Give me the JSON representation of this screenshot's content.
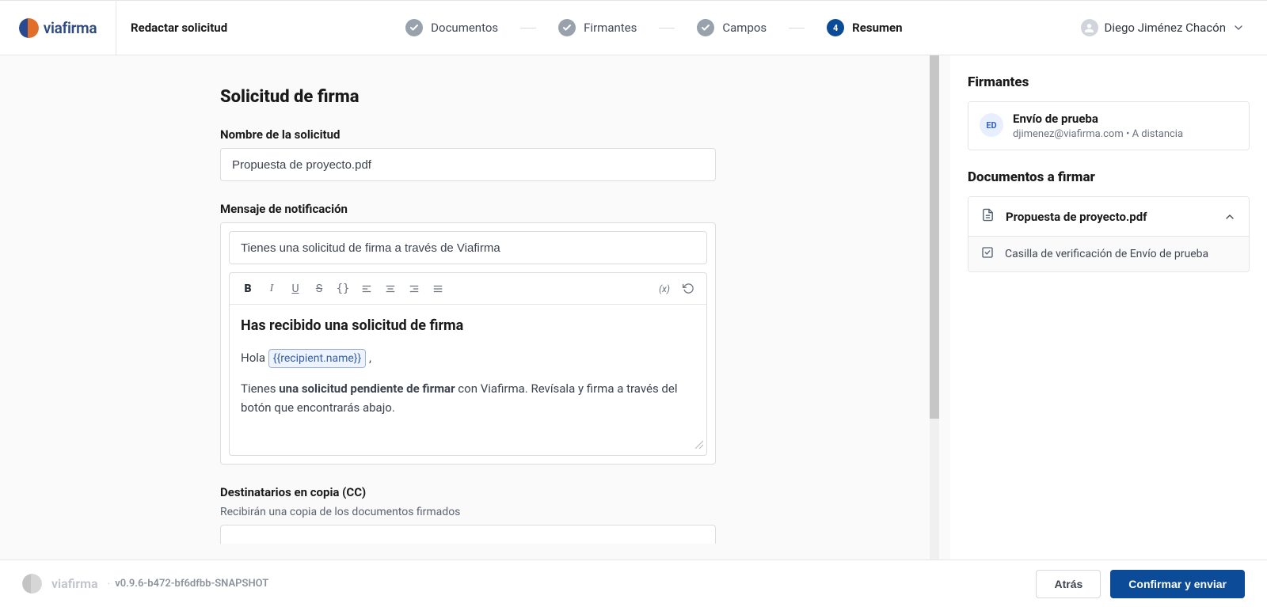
{
  "brand": {
    "name": "viafirma"
  },
  "header": {
    "page_label": "Redactar solicitud",
    "steps": [
      {
        "label": "Documentos"
      },
      {
        "label": "Firmantes"
      },
      {
        "label": "Campos"
      },
      {
        "label": "Resumen",
        "number": "4"
      }
    ],
    "user_name": "Diego Jiménez Chacón"
  },
  "form": {
    "title": "Solicitud de firma",
    "name_label": "Nombre de la solicitud",
    "name_value": "Propuesta de proyecto.pdf",
    "message_label": "Mensaje de notificación",
    "subject_value": "Tienes una solicitud de firma a través de Viafirma",
    "body": {
      "heading": "Has recibido una solicitud de firma",
      "greeting_prefix": "Hola ",
      "variable": "{{recipient.name}}",
      "greeting_suffix": " ,",
      "p2_a": "Tienes ",
      "p2_bold": "una solicitud pendiente de firmar",
      "p2_b": " con Viafirma. Revísala y firma a través del botón que encontrarás abajo."
    },
    "cc_label": "Destinatarios en copia (CC)",
    "cc_sub": "Recibirán una copia de los documentos firmados"
  },
  "toolbar": {
    "var_label": "(x)"
  },
  "sidebar": {
    "signers_title": "Firmantes",
    "signer": {
      "initials": "ED",
      "name": "Envío de prueba",
      "email": "djimenez@viafirma.com",
      "mode": "A distancia"
    },
    "docs_title": "Documentos a firmar",
    "doc_name": "Propuesta de proyecto.pdf",
    "field_label": "Casilla de verificación de Envío de prueba"
  },
  "footer": {
    "version": "v0.9.6-b472-bf6dfbb-SNAPSHOT",
    "back": "Atrás",
    "confirm": "Confirmar y enviar"
  }
}
